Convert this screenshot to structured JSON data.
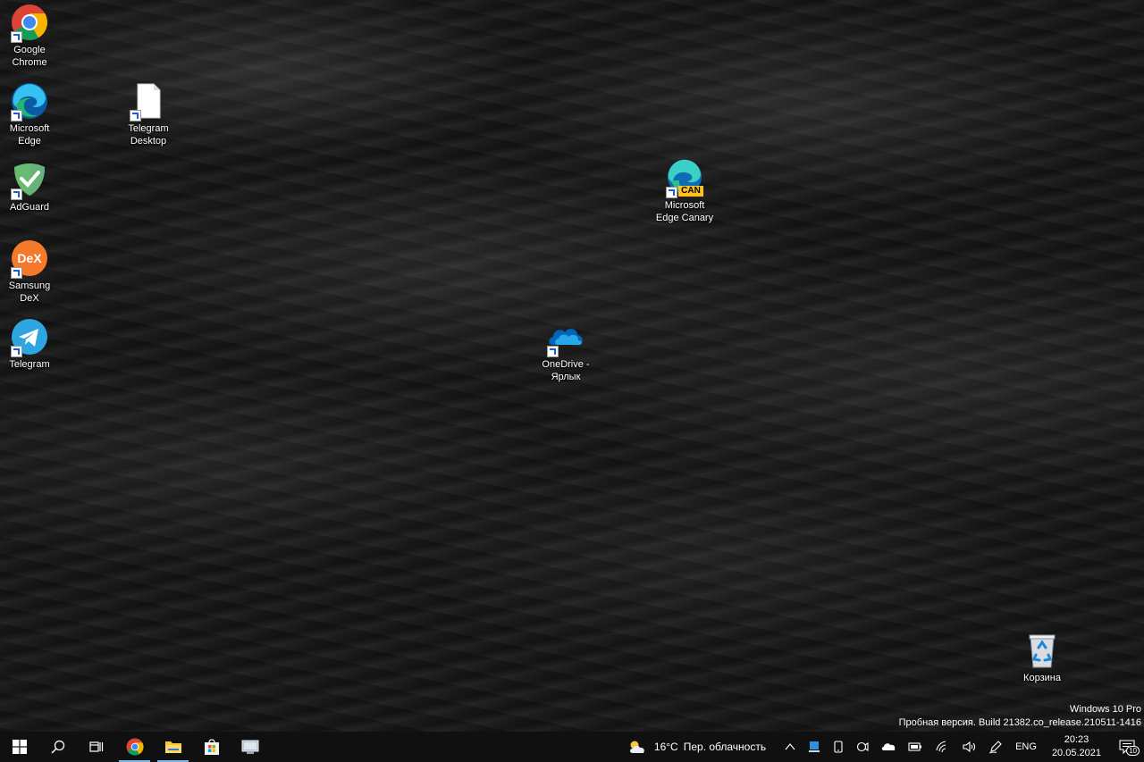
{
  "desktop": {
    "icons": [
      {
        "id": "chrome",
        "label": "Google\nChrome"
      },
      {
        "id": "edge",
        "label": "Microsoft\nEdge"
      },
      {
        "id": "adguard",
        "label": "AdGuard"
      },
      {
        "id": "dex",
        "label": "Samsung\nDeX",
        "badge": "DeX"
      },
      {
        "id": "telegram",
        "label": "Telegram"
      },
      {
        "id": "telegram-desktop",
        "label": "Telegram\nDesktop"
      },
      {
        "id": "edge-canary",
        "label": "Microsoft\nEdge Canary",
        "badge": "CAN"
      },
      {
        "id": "onedrive",
        "label": "OneDrive -\nЯрлык"
      },
      {
        "id": "recycle-bin",
        "label": "Корзина"
      }
    ]
  },
  "watermark": {
    "line1": "Windows 10 Pro",
    "line2": "Пробная версия. Build 21382.co_release.210511-1416"
  },
  "taskbar": {
    "weather": {
      "temp": "16°C",
      "condition": "Пер. облачность"
    },
    "language": "ENG",
    "clock": {
      "time": "20:23",
      "date": "20.05.2021"
    },
    "notifications_count": "10"
  },
  "colors": {
    "taskbar_bg": "#101010",
    "accent": "#76b9ed"
  }
}
